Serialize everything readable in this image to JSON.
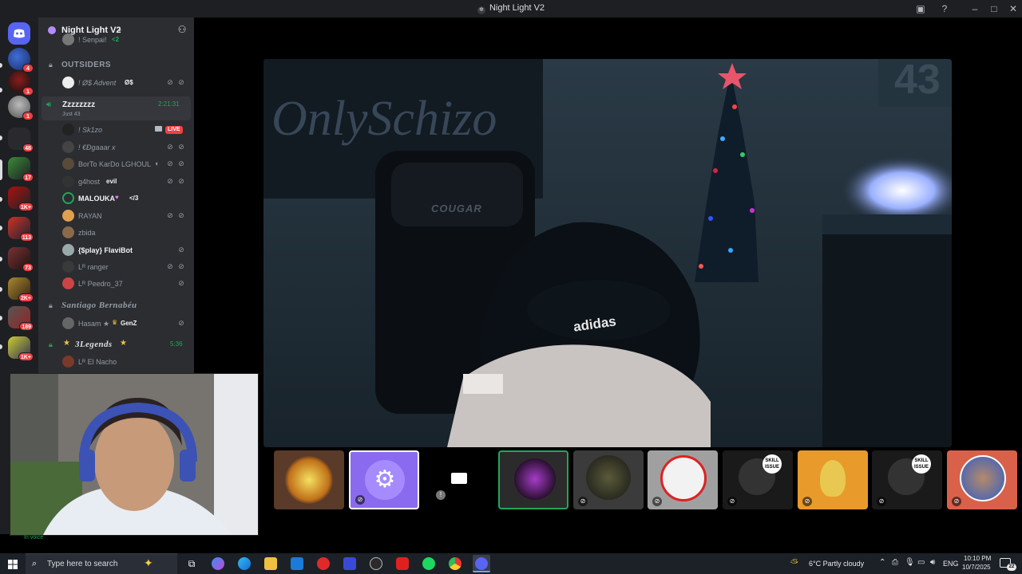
{
  "window": {
    "title": "Night Light V2",
    "icons": [
      "inbox-icon",
      "help-icon",
      "minimize-icon",
      "maximize-icon",
      "close-icon"
    ]
  },
  "server_rail": {
    "badges": [
      "4",
      "1",
      "1",
      "48",
      "17",
      "1K+",
      "113",
      "73",
      "2K+",
      "189",
      "1K+"
    ]
  },
  "server": {
    "name": "Night Light V2"
  },
  "channels": {
    "top_partial_user": "! Senpai!",
    "top_partial_tag": "<2",
    "category_outsiders": "OUTSIDERS",
    "outsiders_user": "! Ø$ Advent",
    "outsiders_user_tag": "Ø$",
    "voice_channel": {
      "name": "Zzzzzzzz",
      "timer": "2:21:31",
      "status": "Just 43"
    },
    "members": [
      {
        "name": "! Sk1zo",
        "badge": "LIVE"
      },
      {
        "name": "! €Ðgaaar x"
      },
      {
        "name": "BorTo KarDo LGHOUL"
      },
      {
        "name": "g4host",
        "tag": "evil"
      },
      {
        "name": "MALOUKA",
        "tag": "</3"
      },
      {
        "name": "RAYAN"
      },
      {
        "name": "zbida"
      },
      {
        "name": "{$play} FlaviBot"
      },
      {
        "name": "Lᴿ ranger"
      },
      {
        "name": "Lᴿ Peedro_37"
      }
    ],
    "channel_santiago": "Santiago Bernabéu",
    "santiago_user": "Hasam ★",
    "santiago_user_tag": "GenZ",
    "channel_legends": "3Legends",
    "legends_timer": "5:36",
    "legends_user": "Lᴿ El Nacho"
  },
  "voice_panel": {
    "status": "In voice"
  },
  "stream": {
    "wall_text": "OnlySchizo",
    "number": "43",
    "chair_brand": "COUGAR",
    "hat_brand": "adidas"
  },
  "tiles": [
    {
      "label": "avatar-fire"
    },
    {
      "label": "avatar-music"
    },
    {
      "label": "camera-off"
    },
    {
      "label": "avatar-mask"
    },
    {
      "label": "avatar-emblem"
    },
    {
      "label": "avatar-sunglasses"
    },
    {
      "label": "avatar-skill-issue-1",
      "sticker": "SKILL ISSUE"
    },
    {
      "label": "avatar-duck"
    },
    {
      "label": "avatar-skill-issue-2",
      "sticker": "SKILL ISSUE"
    },
    {
      "label": "avatar-portrait"
    }
  ],
  "taskbar": {
    "search_placeholder": "Type here to search",
    "weather": "6°C  Partly cloudy",
    "language": "ENG",
    "time": "10:10 PM",
    "date": "10/7/2025",
    "notifications": "22"
  },
  "colors": {
    "accent": "#5865f2",
    "online": "#23a55a",
    "live": "#f23f43",
    "sidebar": "#2b2d31",
    "rail": "#1e1f22"
  }
}
